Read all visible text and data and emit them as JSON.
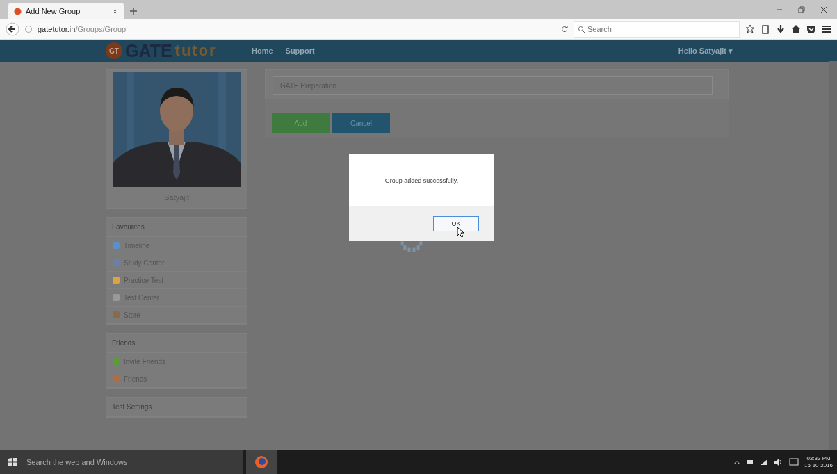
{
  "browser": {
    "tab_title": "Add New Group",
    "url_host": "gatetutor.in",
    "url_path": "/Groups/Group",
    "search_placeholder": "Search"
  },
  "site": {
    "logo_badge": "GT",
    "logo_main": "GATE",
    "logo_accent": "tutor",
    "nav": [
      "Home",
      "Support"
    ],
    "user_menu": "Hello Satyajit",
    "user_menu_caret": "▾"
  },
  "profile": {
    "name": "Satyajit"
  },
  "sidebar": [
    {
      "title": "Favourites",
      "items": [
        {
          "label": "Timeline",
          "color": "#5b8fc9"
        },
        {
          "label": "Study Center",
          "color": "#6a7fb0"
        },
        {
          "label": "Practice Test",
          "color": "#d9a441"
        },
        {
          "label": "Test Center",
          "color": "#999999"
        },
        {
          "label": "Store",
          "color": "#8a6a4a"
        }
      ]
    },
    {
      "title": "Friends",
      "items": [
        {
          "label": "Invite Friends",
          "color": "#5c9a3a"
        },
        {
          "label": "Friends",
          "color": "#b86a3a"
        }
      ]
    },
    {
      "title": "Test Settings"
    }
  ],
  "form": {
    "group_name": "GATE Preparation",
    "buttons": [
      {
        "label": "Add",
        "kind": "primary"
      },
      {
        "label": "Cancel",
        "kind": "secondary"
      }
    ]
  },
  "dialog": {
    "message": "Group added successfully.",
    "button": "OK"
  },
  "taskbar": {
    "search_placeholder": "Search the web and Windows",
    "time": "03:33 PM",
    "date": "15-10-2016"
  }
}
